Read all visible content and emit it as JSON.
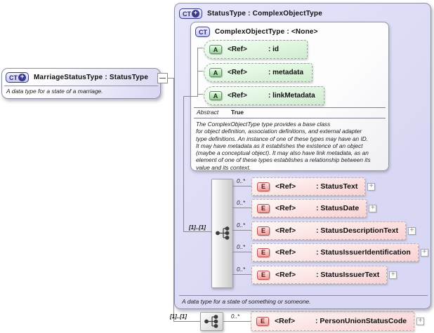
{
  "colors": {
    "container_fill": "#d8d8f4",
    "attribute_fill": "#d8efd8",
    "element_fill": "#fad8d8",
    "icon_navy": "#3c3c8c",
    "attribute_border": "#97a897",
    "element_icon_border": "#b45252"
  },
  "icons": {
    "ct": "CT",
    "a": "A",
    "e": "E",
    "plus": "+"
  },
  "left_box": {
    "title": "MarriageStatusType : StatusType",
    "annotation": "A data type for a state of a marriage."
  },
  "main_box": {
    "title": "StatusType : ComplexObjectType",
    "annotation": "A data type for a state of something or someone.",
    "base_type": {
      "title": "ComplexObjectType : <None>",
      "attributes": [
        {
          "ref": "<Ref>",
          "name": ": id"
        },
        {
          "ref": "<Ref>",
          "name": ": metadata"
        },
        {
          "ref": "<Ref>",
          "name": ": linkMetadata"
        }
      ],
      "abstract_label": "Abstract",
      "abstract_value": "True",
      "description": "The ComplexObjectType type provides a base class\nfor object definition, association definitions, and external adapter\ntype definitions. An instance of one of these types may have an ID.\nIt may have metadata as it establishes the existence of an object\n(maybe a conceptual object). It may also have link metadata, as an\nelement of one of these types establishes a relationship between its\nvalue and its context."
    },
    "sequence": {
      "cardinality": "[1]..[1]",
      "elements": [
        {
          "cardinality": "0..*",
          "ref": "<Ref>",
          "name": ": StatusText"
        },
        {
          "cardinality": "0..*",
          "ref": "<Ref>",
          "name": ": StatusDate"
        },
        {
          "cardinality": "0..*",
          "ref": "<Ref>",
          "name": ": StatusDescriptionText"
        },
        {
          "cardinality": "0..*",
          "ref": "<Ref>",
          "name": ": StatusIssuerIdentification"
        },
        {
          "cardinality": "0..*",
          "ref": "<Ref>",
          "name": ": StatusIssuerText"
        }
      ]
    }
  },
  "extension": {
    "cardinality": "[1]..[1]",
    "elements": [
      {
        "cardinality": "0..*",
        "ref": "<Ref>",
        "name": ": PersonUnionStatusCode"
      }
    ]
  }
}
